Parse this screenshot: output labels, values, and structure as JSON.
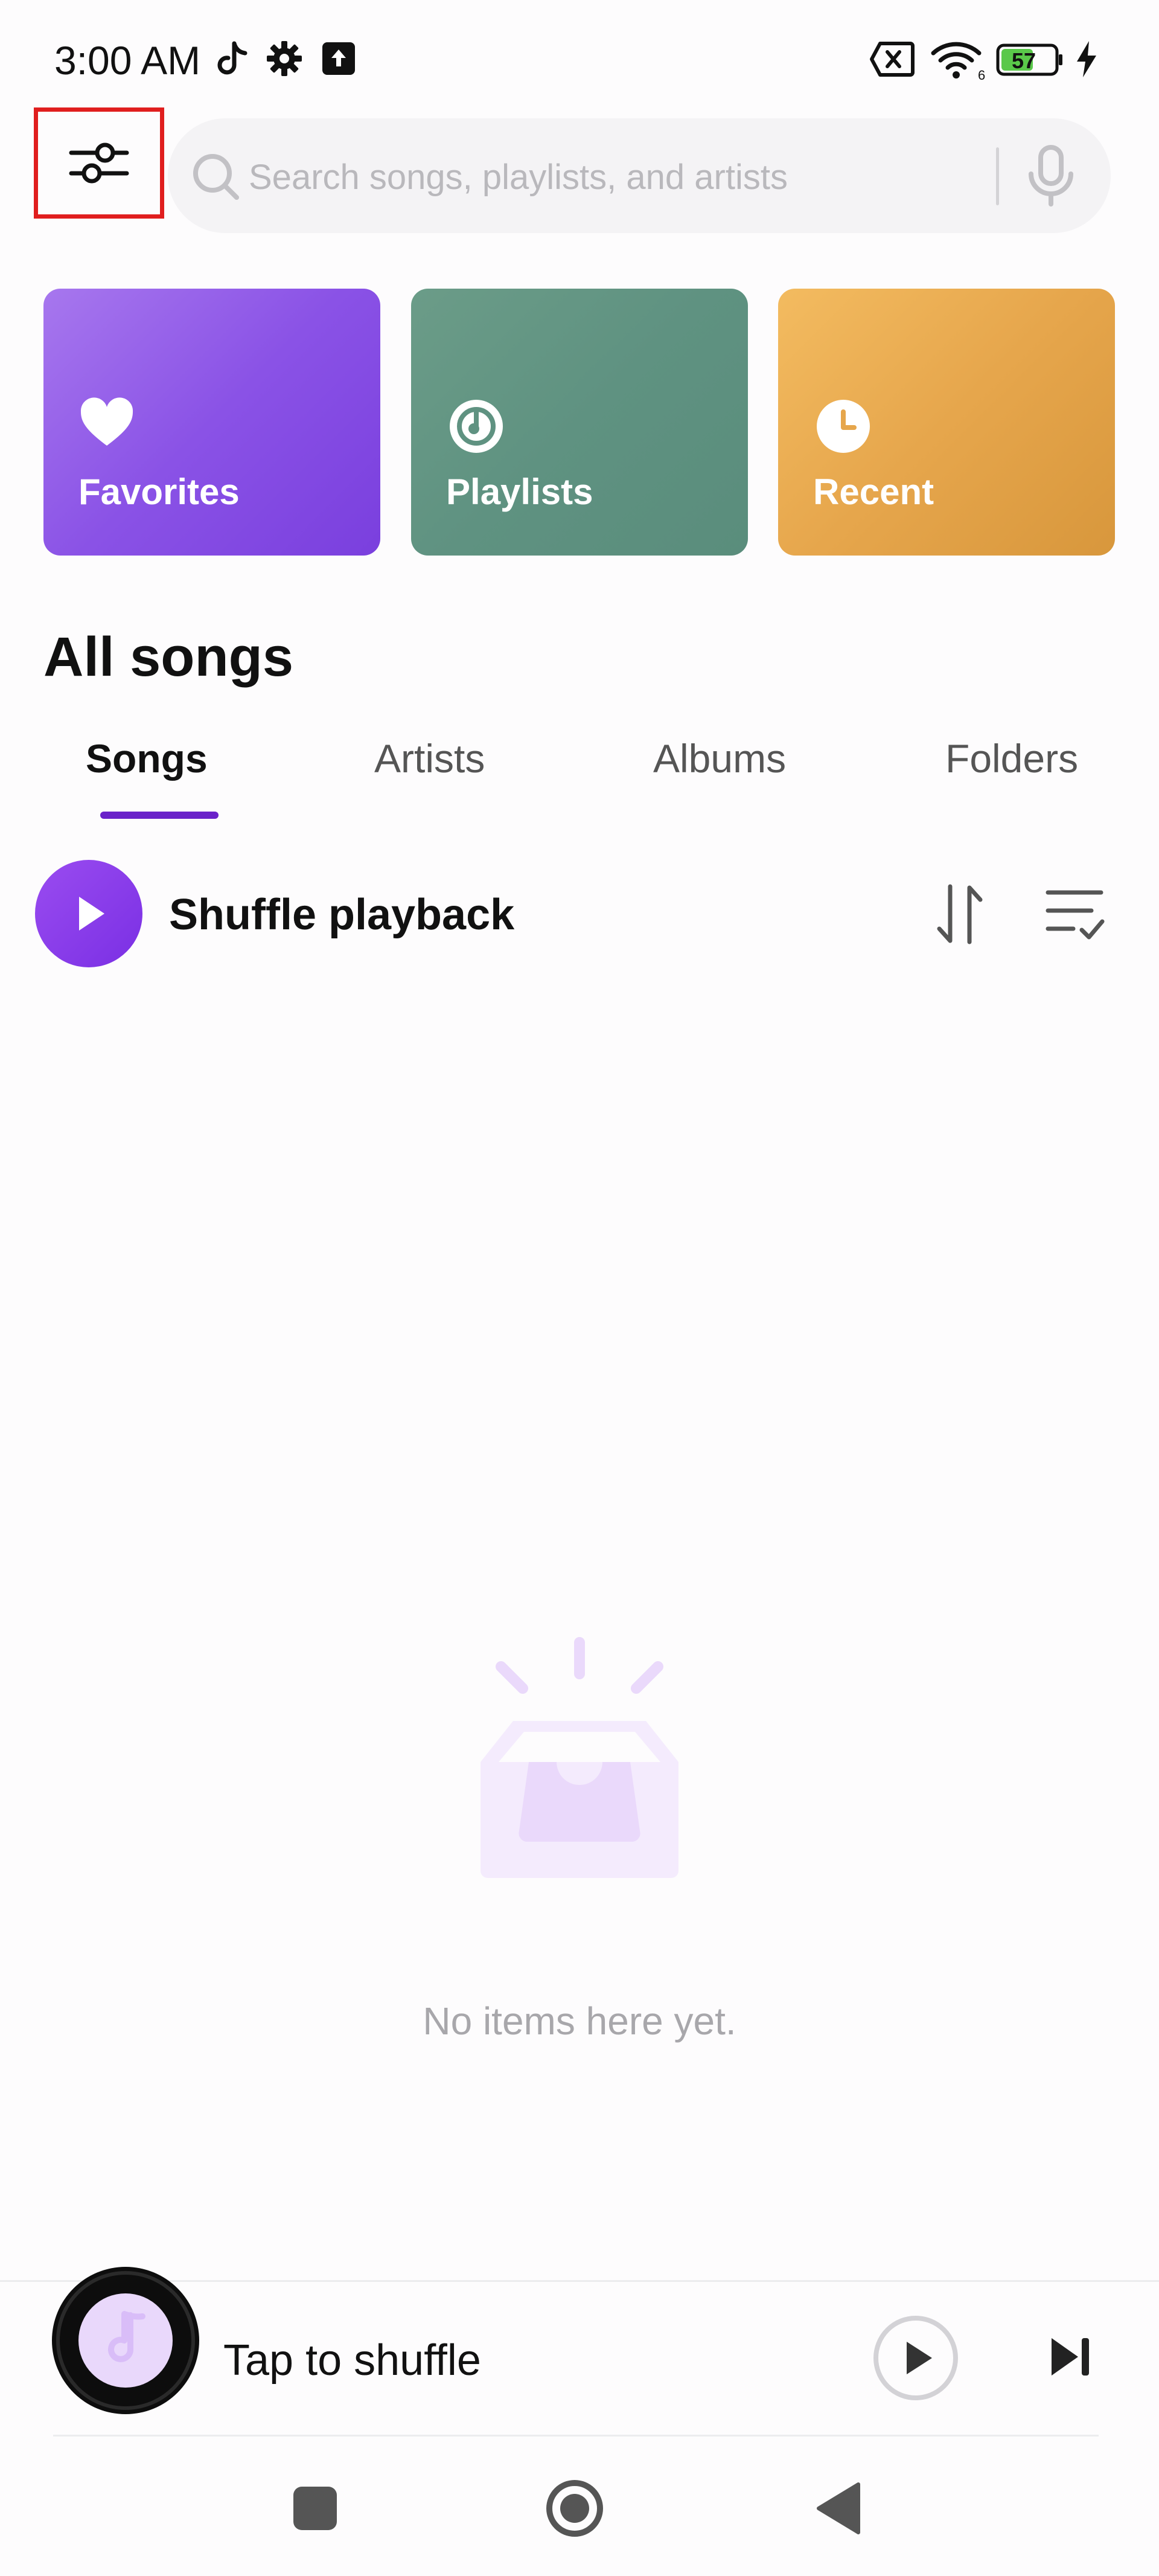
{
  "status_bar": {
    "time": "3:00 AM",
    "battery_level": "57",
    "icons": [
      "tiktok-icon",
      "settings-gear-icon",
      "upload-icon",
      "sim-disabled-icon",
      "wifi-icon",
      "battery-icon",
      "charging-icon"
    ]
  },
  "header": {
    "filter_icon": "sliders-icon",
    "search": {
      "placeholder": "Search songs, playlists, and artists",
      "value": ""
    },
    "mic_icon": "microphone-icon"
  },
  "quick_cards": [
    {
      "label": "Favorites",
      "icon": "heart-icon",
      "color": "#8a52e6"
    },
    {
      "label": "Playlists",
      "icon": "playlist-disc-icon",
      "color": "#5f9281"
    },
    {
      "label": "Recent",
      "icon": "clock-icon",
      "color": "#e6a64c"
    }
  ],
  "section": {
    "title": "All songs"
  },
  "tabs": [
    {
      "label": "Songs",
      "active": true
    },
    {
      "label": "Artists",
      "active": false
    },
    {
      "label": "Albums",
      "active": false
    },
    {
      "label": "Folders",
      "active": false
    }
  ],
  "shuffle": {
    "label": "Shuffle playback"
  },
  "empty_state": {
    "message": "No items here yet."
  },
  "mini_player": {
    "label": "Tap to shuffle"
  },
  "nav_bar": {
    "buttons": [
      "recents-square-icon",
      "home-circle-icon",
      "back-triangle-icon"
    ]
  },
  "colors": {
    "accent": "#6a22c9",
    "highlight_box": "#e01e1e"
  }
}
